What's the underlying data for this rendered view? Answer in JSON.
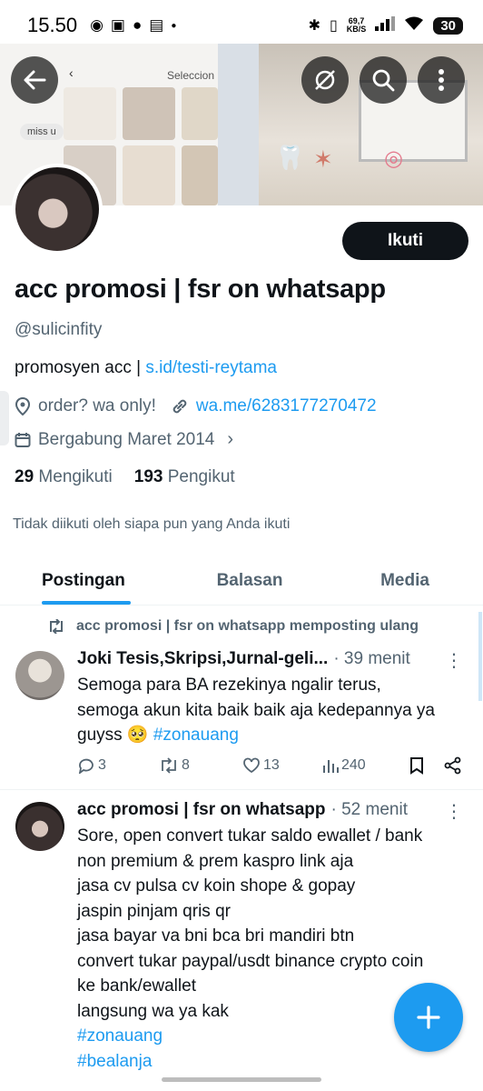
{
  "status_bar": {
    "time": "15.50",
    "net_speed": "69,7",
    "net_unit": "KB/S",
    "battery": "30"
  },
  "banner": {
    "screenshot_header": "Seleccion",
    "chat_bubble": "miss u"
  },
  "profile": {
    "display_name": "acc promosi | fsr on whatsapp",
    "handle": "@sulicinfity",
    "follow_label": "Ikuti",
    "bio_text": "promosyen acc | ",
    "bio_link": "s.id/testi-reytama",
    "location": "order? wa only!",
    "website": "wa.me/6283177270472",
    "joined": "Bergabung Maret 2014",
    "following_count": "29",
    "following_label": "Mengikuti",
    "followers_count": "193",
    "followers_label": "Pengikut",
    "not_followed_note": "Tidak diikuti oleh siapa pun yang Anda ikuti"
  },
  "tabs": [
    {
      "label": "Postingan",
      "active": true
    },
    {
      "label": "Balasan",
      "active": false
    },
    {
      "label": "Media",
      "active": false
    }
  ],
  "posts": [
    {
      "repost_note": "acc promosi | fsr on whatsapp memposting ulang",
      "author": "Joki Tesis,Skripsi,Jurnal-geli...",
      "time": "· 39 menit",
      "text_lines": [
        "Semoga para BA rezekinya ngalir terus,",
        "semoga akun kita baik baik aja kedepannya ya"
      ],
      "last_line_text": "guyss 🥺 ",
      "last_line_hashtag": "#zonauang",
      "replies": "3",
      "reposts": "8",
      "likes": "13",
      "views": "240"
    },
    {
      "author": "acc promosi | fsr on whatsapp",
      "time": "· 52 menit",
      "text_lines": [
        "Sore, open convert tukar saldo ewallet / bank",
        "non premium & prem kaspro link aja",
        "jasa cv pulsa cv koin shope & gopay",
        "jaspin pinjam qris qr",
        "jasa bayar va bni bca bri mandiri btn",
        "convert tukar paypal/usdt binance crypto coin",
        "ke bank/ewallet",
        "langsung wa ya kak"
      ],
      "hashtags": [
        "#zonauang",
        "#bealanja"
      ]
    }
  ],
  "colors": {
    "accent": "#1d9bf0",
    "text": "#0f1419",
    "secondary": "#536471"
  }
}
